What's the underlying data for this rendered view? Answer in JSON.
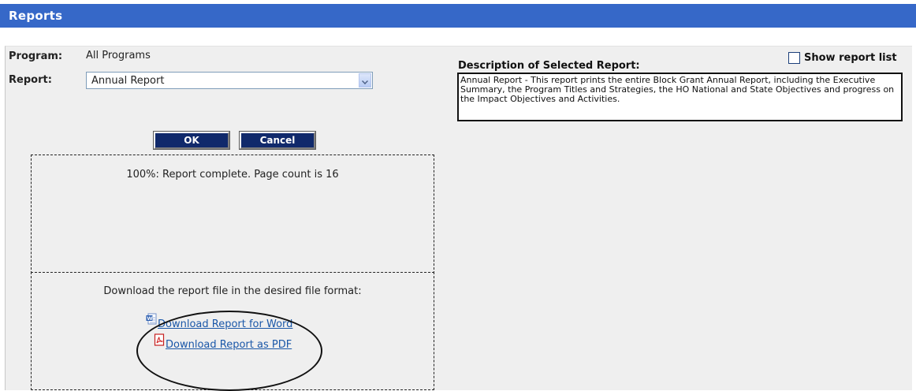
{
  "header": {
    "title": "Reports"
  },
  "form": {
    "program_label": "Program:",
    "program_value": "All Programs",
    "report_label": "Report:",
    "report_selected": "Annual Report",
    "ok_label": "OK",
    "cancel_label": "Cancel"
  },
  "progress": {
    "status_text": "100%: Report complete. Page count is 16",
    "percent": 100,
    "page_count": 16
  },
  "download": {
    "instruction": "Download the report file in the desired file format:",
    "word_link": "Download Report for Word",
    "pdf_link": "Download Report as PDF",
    "word_icon": "word-document-icon",
    "pdf_icon": "pdf-document-icon"
  },
  "description": {
    "title": "Description of Selected Report:",
    "text": "Annual Report - This report prints the entire Block Grant Annual Report, including the Executive Summary, the Program Titles and Strategies, the HO National and State Objectives and progress on the Impact Objectives and Activities."
  },
  "options": {
    "show_report_list_label": "Show report list",
    "show_report_list_checked": false
  },
  "colors": {
    "header_bg": "#3668c8",
    "button_bg": "#10296b",
    "link": "#1a57a8",
    "panel_bg": "#efefef"
  }
}
